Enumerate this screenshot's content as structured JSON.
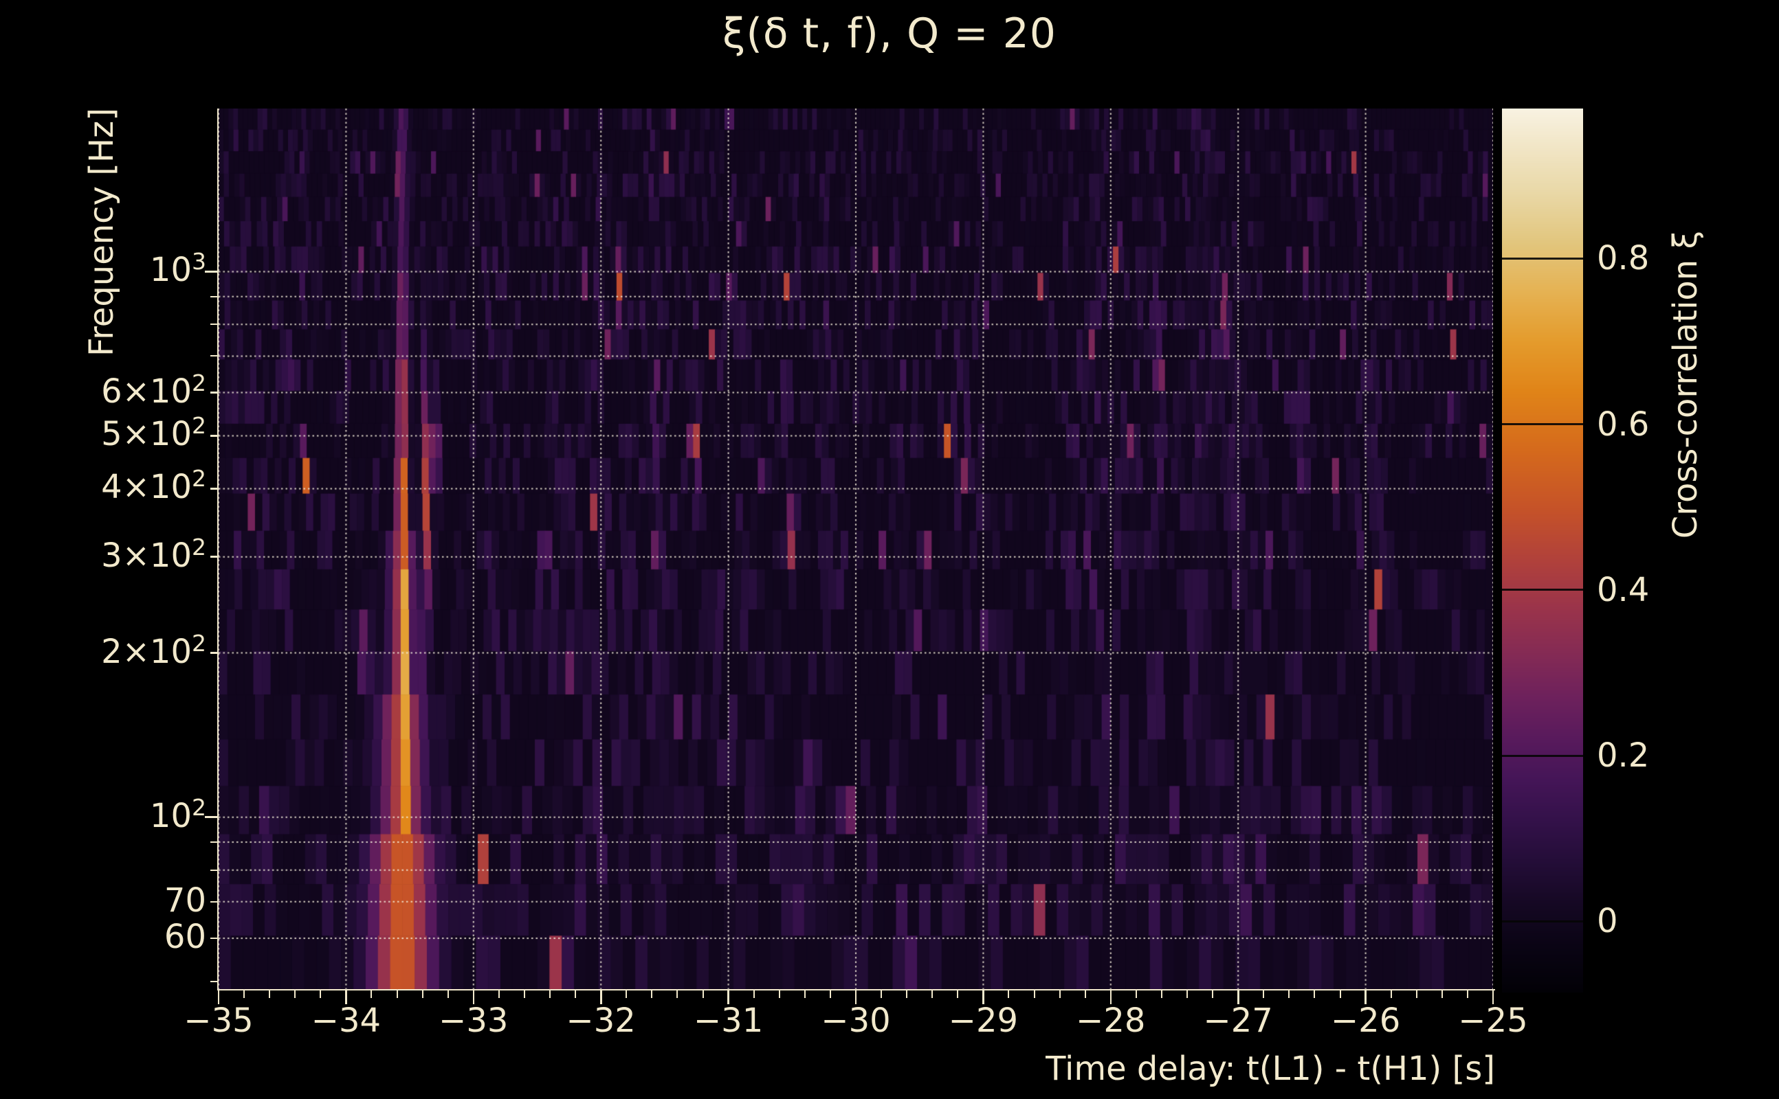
{
  "chart_data": {
    "type": "heatmap",
    "title": "ξ(δ t, f), Q = 20",
    "xlabel": "Time delay: t(L1) - t(H1) [s]",
    "ylabel": "Frequency [Hz]",
    "colorbar_label": "Cross-correlation ξ",
    "x_range_s": [
      -35,
      -25
    ],
    "y_range_hz": [
      48.4,
      1990
    ],
    "y_scale": "log",
    "grid": "dotted",
    "legend": "none",
    "x_ticks": [
      {
        "v": -35,
        "label": "−35"
      },
      {
        "v": -34,
        "label": "−34"
      },
      {
        "v": -33,
        "label": "−33"
      },
      {
        "v": -32,
        "label": "−32"
      },
      {
        "v": -31,
        "label": "−31"
      },
      {
        "v": -30,
        "label": "−30"
      },
      {
        "v": -29,
        "label": "−29"
      },
      {
        "v": -28,
        "label": "−28"
      },
      {
        "v": -27,
        "label": "−27"
      },
      {
        "v": -26,
        "label": "−26"
      },
      {
        "v": -25,
        "label": "−25"
      }
    ],
    "x_minor_step_s": 0.2,
    "y_ticks": [
      {
        "f": 1000,
        "label": "10^3"
      },
      {
        "f": 600,
        "label": "6×10^2"
      },
      {
        "f": 500,
        "label": "5×10^2"
      },
      {
        "f": 400,
        "label": "4×10^2"
      },
      {
        "f": 300,
        "label": "3×10^2"
      },
      {
        "f": 200,
        "label": "2×10^2"
      },
      {
        "f": 100,
        "label": "10^2"
      },
      {
        "f": 70,
        "label": "70"
      },
      {
        "f": 60,
        "label": "60"
      }
    ],
    "y_gridlines_unlabeled_hz": [
      900,
      800,
      700,
      90,
      80
    ],
    "y_minor_tick_only_hz": [
      50
    ],
    "colorbar": {
      "value_range": [
        -0.086,
        0.981
      ],
      "ticks": [
        {
          "v": 0.8,
          "label": "0.8"
        },
        {
          "v": 0.6,
          "label": "0.6"
        },
        {
          "v": 0.4,
          "label": "0.4"
        },
        {
          "v": 0.2,
          "label": "0.2"
        },
        {
          "v": 0.0,
          "label": "0"
        }
      ]
    },
    "colormap_stops": [
      [
        -0.086,
        "#020106"
      ],
      [
        -0.03,
        "#0a0414"
      ],
      [
        0.02,
        "#150823"
      ],
      [
        0.07,
        "#230d37"
      ],
      [
        0.12,
        "#331149"
      ],
      [
        0.17,
        "#441557"
      ],
      [
        0.22,
        "#581a5c"
      ],
      [
        0.27,
        "#6d215c"
      ],
      [
        0.32,
        "#832a55"
      ],
      [
        0.38,
        "#9b344a"
      ],
      [
        0.44,
        "#b2423a"
      ],
      [
        0.5,
        "#c65328"
      ],
      [
        0.57,
        "#d56a1c"
      ],
      [
        0.64,
        "#e08418"
      ],
      [
        0.7,
        "#e49b2c"
      ],
      [
        0.76,
        "#e5b253"
      ],
      [
        0.82,
        "#e2c67e"
      ],
      [
        0.88,
        "#e9d8a7"
      ],
      [
        0.94,
        "#f2e7c9"
      ],
      [
        0.981,
        "#f8f2e2"
      ]
    ],
    "features": {
      "main_streak": {
        "t_s": -33.56,
        "core_sigma_s": 0.032,
        "bands": [
          {
            "f": [
              48,
              120
            ],
            "amp": 0.96
          },
          {
            "f": [
              120,
              200
            ],
            "amp": 0.95
          },
          {
            "f": [
              200,
              300
            ],
            "amp": 0.88
          },
          {
            "f": [
              300,
              450
            ],
            "amp": 0.62
          },
          {
            "f": [
              450,
              700
            ],
            "amp": 0.45
          },
          {
            "f": [
              700,
              1000
            ],
            "amp": 0.3
          },
          {
            "f": [
              1000,
              1990
            ],
            "amp": 0.2
          }
        ],
        "halo": [
          {
            "f": [
              48,
              100
            ],
            "sigma_s": 0.17,
            "amp": 0.52
          },
          {
            "f": [
              100,
              160
            ],
            "sigma_s": 0.12,
            "amp": 0.45
          },
          {
            "f": [
              160,
              320
            ],
            "sigma_s": 0.07,
            "amp": 0.4
          }
        ]
      },
      "spots": [
        {
          "t_s": -33.38,
          "f_hz": 320,
          "f_sigma_log": 0.22,
          "amp": 0.5,
          "sigma_s": 0.022
        },
        {
          "t_s": -33.3,
          "f_hz": 465,
          "f_sigma_log": 0.045,
          "amp": 0.66,
          "sigma_s": 0.02
        },
        {
          "t_s": -31.85,
          "f_hz": 950,
          "f_sigma_log": 0.05,
          "amp": 0.5,
          "sigma_s": 0.018
        },
        {
          "t_s": -31.25,
          "f_hz": 480,
          "f_sigma_log": 0.05,
          "amp": 0.42,
          "sigma_s": 0.018
        },
        {
          "t_s": -30.5,
          "f_hz": 330,
          "f_sigma_log": 0.05,
          "amp": 0.45,
          "sigma_s": 0.02
        },
        {
          "t_s": -30.4,
          "f_hz": 110,
          "f_sigma_log": 0.06,
          "amp": 0.4,
          "sigma_s": 0.025
        },
        {
          "t_s": -27.1,
          "f_hz": 840,
          "f_sigma_log": 0.05,
          "amp": 0.45,
          "sigma_s": 0.018
        },
        {
          "t_s": -33.85,
          "f_hz": 200,
          "f_sigma_log": 0.05,
          "amp": 0.36,
          "sigma_s": 0.03
        },
        {
          "t_s": -25.55,
          "f_hz": 78,
          "f_sigma_log": 0.07,
          "amp": 0.33,
          "sigma_s": 0.04
        }
      ]
    },
    "noise": {
      "seed": 42,
      "background_value_range": [
        -0.05,
        0.13
      ],
      "speckle_probability": 0.018,
      "bright_speckle_probability": 0.0025,
      "texture": "vertical-striped Q-transform tiles, coarser at low frequency"
    },
    "colors": {
      "figure_background": "#000000",
      "text": "#f2e9cc",
      "gridline": "#f5eedb",
      "axis": "#f2e9cc",
      "colorbar_tick": "#050505"
    }
  }
}
